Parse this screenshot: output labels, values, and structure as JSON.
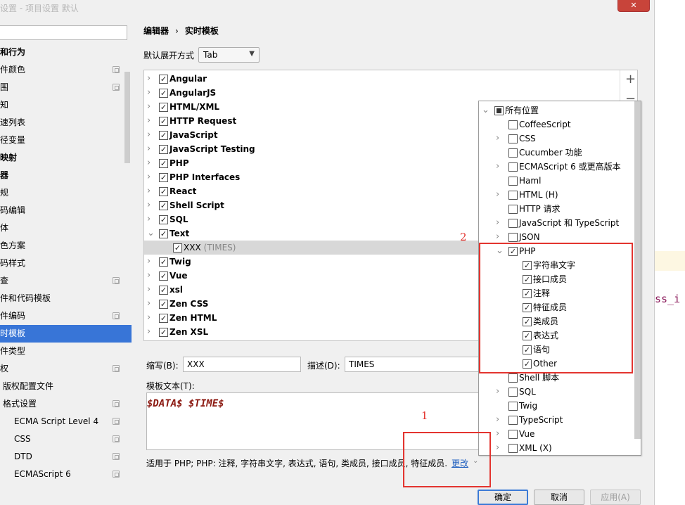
{
  "window": {
    "title_fragment": "设置 - 项目设置 默认",
    "close_label": "✕"
  },
  "background_editor": {
    "code_text": "ss_i"
  },
  "sidebar": {
    "items": [
      {
        "label": "和行为",
        "bold": true,
        "copy": false
      },
      {
        "label": "件颜色",
        "bold": false,
        "copy": true
      },
      {
        "label": "围",
        "bold": false,
        "copy": true
      },
      {
        "label": "知",
        "bold": false,
        "copy": false
      },
      {
        "label": "速列表",
        "bold": false,
        "copy": false
      },
      {
        "label": "径变量",
        "bold": false,
        "copy": false
      },
      {
        "label": "映射",
        "bold": true,
        "copy": false
      },
      {
        "label": "器",
        "bold": true,
        "copy": false
      },
      {
        "label": "规",
        "bold": false,
        "copy": false
      },
      {
        "label": "码编辑",
        "bold": false,
        "copy": false
      },
      {
        "label": "体",
        "bold": false,
        "copy": false
      },
      {
        "label": "色方案",
        "bold": false,
        "copy": false
      },
      {
        "label": "码样式",
        "bold": false,
        "copy": false
      },
      {
        "label": "查",
        "bold": false,
        "copy": true
      },
      {
        "label": "件和代码模板",
        "bold": false,
        "copy": false
      },
      {
        "label": "件编码",
        "bold": false,
        "copy": true
      },
      {
        "label": "时模板",
        "bold": false,
        "copy": false,
        "selected": true
      },
      {
        "label": "件类型",
        "bold": false,
        "copy": false
      },
      {
        "label": "权",
        "bold": false,
        "copy": true
      },
      {
        "label": "版权配置文件",
        "bold": false,
        "copy": false,
        "indent": 4
      },
      {
        "label": "格式设置",
        "bold": false,
        "copy": true,
        "indent": 4
      },
      {
        "label": "ECMA Script Level 4",
        "bold": false,
        "copy": true,
        "indent": 20
      },
      {
        "label": "CSS",
        "bold": false,
        "copy": true,
        "indent": 20
      },
      {
        "label": "DTD",
        "bold": false,
        "copy": true,
        "indent": 20
      },
      {
        "label": "ECMAScript 6",
        "bold": false,
        "copy": true,
        "indent": 20
      }
    ]
  },
  "breadcrumb": {
    "parent": "编辑器",
    "separator": "›",
    "current": "实时模板"
  },
  "expand": {
    "label": "默认展开方式",
    "value": "Tab"
  },
  "template_groups": [
    {
      "label": "Angular",
      "checked": true,
      "expanded": false
    },
    {
      "label": "AngularJS",
      "checked": true,
      "expanded": false
    },
    {
      "label": "HTML/XML",
      "checked": true,
      "expanded": false
    },
    {
      "label": "HTTP Request",
      "checked": true,
      "expanded": false
    },
    {
      "label": "JavaScript",
      "checked": true,
      "expanded": false
    },
    {
      "label": "JavaScript Testing",
      "checked": true,
      "expanded": false
    },
    {
      "label": "PHP",
      "checked": true,
      "expanded": false
    },
    {
      "label": "PHP Interfaces",
      "checked": true,
      "expanded": false
    },
    {
      "label": "React",
      "checked": true,
      "expanded": false
    },
    {
      "label": "Shell Script",
      "checked": true,
      "expanded": false
    },
    {
      "label": "SQL",
      "checked": true,
      "expanded": false
    },
    {
      "label": "Text",
      "checked": true,
      "expanded": true
    },
    {
      "label": "XXX",
      "desc": "(TIMES)",
      "checked": true,
      "child": true
    },
    {
      "label": "Twig",
      "checked": true,
      "expanded": false
    },
    {
      "label": "Vue",
      "checked": true,
      "expanded": false
    },
    {
      "label": "xsl",
      "checked": true,
      "expanded": false
    },
    {
      "label": "Zen CSS",
      "checked": true,
      "expanded": false
    },
    {
      "label": "Zen HTML",
      "checked": true,
      "expanded": false
    },
    {
      "label": "Zen XSL",
      "checked": true,
      "expanded": false
    }
  ],
  "toolbar": {
    "add": "+",
    "remove": "−"
  },
  "abbrev": {
    "label": "缩写(B):",
    "value": "XXX"
  },
  "description": {
    "label": "描述(D):",
    "value": "TIMES"
  },
  "template_text": {
    "label": "模板文本(T):",
    "value": "$DATA$ $TIME$"
  },
  "applies_to": {
    "text": "适用于 PHP; PHP: 注释, 字符串文字, 表达式, 语句, 类成员, 接口成员, 特征成员.",
    "change_label": "更改",
    "chevron": "⌄"
  },
  "context_popup": {
    "items": [
      {
        "label": "所有位置",
        "level": 0,
        "state": "partial",
        "arrow": "down"
      },
      {
        "label": "CoffeeScript",
        "level": 1,
        "state": "off",
        "arrow": "none"
      },
      {
        "label": "CSS",
        "level": 1,
        "state": "off",
        "arrow": "right"
      },
      {
        "label": "Cucumber 功能",
        "level": 1,
        "state": "off",
        "arrow": "none"
      },
      {
        "label": "ECMAScript 6 或更高版本",
        "level": 1,
        "state": "off",
        "arrow": "right"
      },
      {
        "label": "Haml",
        "level": 1,
        "state": "off",
        "arrow": "none"
      },
      {
        "label": "HTML (H)",
        "level": 1,
        "state": "off",
        "arrow": "right"
      },
      {
        "label": "HTTP 请求",
        "level": 1,
        "state": "off",
        "arrow": "none"
      },
      {
        "label": "JavaScript 和 TypeScript",
        "level": 1,
        "state": "off",
        "arrow": "right"
      },
      {
        "label": "JSON",
        "level": 1,
        "state": "off",
        "arrow": "right"
      },
      {
        "label": "PHP",
        "level": 1,
        "state": "on",
        "arrow": "down"
      },
      {
        "label": "字符串文字",
        "level": 2,
        "state": "on",
        "arrow": "none"
      },
      {
        "label": "接口成员",
        "level": 2,
        "state": "on",
        "arrow": "none"
      },
      {
        "label": "注释",
        "level": 2,
        "state": "on",
        "arrow": "none"
      },
      {
        "label": "特征成员",
        "level": 2,
        "state": "on",
        "arrow": "none"
      },
      {
        "label": "类成员",
        "level": 2,
        "state": "on",
        "arrow": "none"
      },
      {
        "label": "表达式",
        "level": 2,
        "state": "on",
        "arrow": "none"
      },
      {
        "label": "语句",
        "level": 2,
        "state": "on",
        "arrow": "none"
      },
      {
        "label": "Other",
        "level": 2,
        "state": "on",
        "arrow": "none"
      },
      {
        "label": "Shell 脚本",
        "level": 1,
        "state": "off",
        "arrow": "none"
      },
      {
        "label": "SQL",
        "level": 1,
        "state": "off",
        "arrow": "right"
      },
      {
        "label": "Twig",
        "level": 1,
        "state": "off",
        "arrow": "none"
      },
      {
        "label": "TypeScript",
        "level": 1,
        "state": "off",
        "arrow": "right"
      },
      {
        "label": "Vue",
        "level": 1,
        "state": "off",
        "arrow": "right"
      },
      {
        "label": "XML (X)",
        "level": 1,
        "state": "off",
        "arrow": "right"
      }
    ]
  },
  "annotations": {
    "label1": "1",
    "label2": "2",
    "color": "#e3342f"
  },
  "buttons": {
    "ok": "确定",
    "cancel": "取消",
    "apply": "应用(A)"
  },
  "colors": {
    "selection": "#3875d7",
    "link": "#1f5fbf",
    "template_text": "#8c1a12"
  }
}
